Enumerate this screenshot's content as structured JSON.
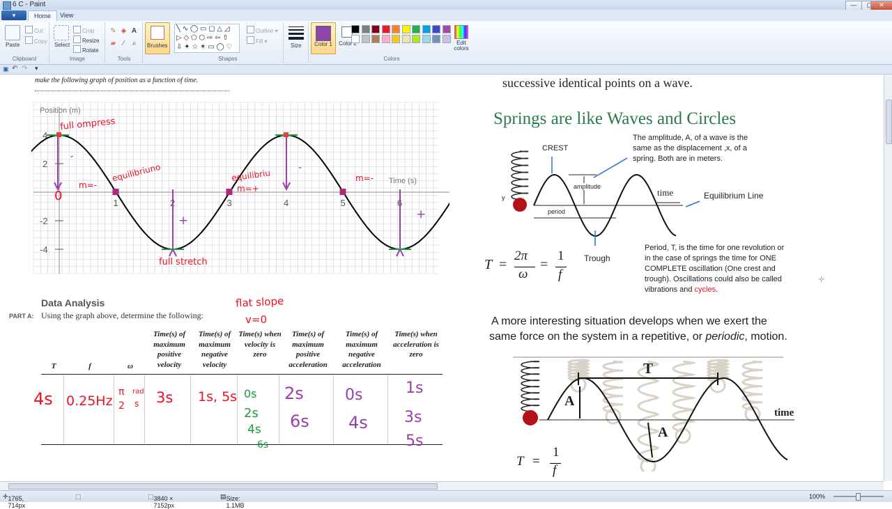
{
  "window": {
    "title": "6 C - Paint",
    "minimize_glyph": "—",
    "maximize_glyph": "▢",
    "close_glyph": "✕"
  },
  "tabs": [
    {
      "label": "Home"
    },
    {
      "label": "View"
    }
  ],
  "ribbon": {
    "clipboard": {
      "label": "Clipboard",
      "paste": "Paste",
      "cut": "Cut",
      "copy": "Copy"
    },
    "image": {
      "label": "Image",
      "select": "Select",
      "crop": "Crop",
      "resize": "Resize",
      "rotate": "Rotate"
    },
    "tools": {
      "label": "Tools",
      "text_glyph": "A"
    },
    "brushes": {
      "label": "Brushes"
    },
    "shapes": {
      "label": "Shapes",
      "outline": "Outline",
      "fill": "Fill"
    },
    "size": {
      "label": "Size"
    },
    "colors": {
      "label": "Colors",
      "color1": "Color 1",
      "color2": "Color 2",
      "edit": "Edit colors",
      "accent": "#8e44ad",
      "palette": [
        "#000000",
        "#7f7f7f",
        "#880015",
        "#ed1c24",
        "#ff7f27",
        "#fff200",
        "#22b14c",
        "#00a2e8",
        "#3f48cc",
        "#a349a4",
        "#ffffff",
        "#c3c3c3",
        "#b97a57",
        "#ffaec9",
        "#ffc90e",
        "#efe4b0",
        "#b5e61d",
        "#99d9ea",
        "#7092be",
        "#c8bfe7"
      ]
    }
  },
  "status": {
    "cursor": "1765, 714px",
    "dimensions": "3840 × 7152px",
    "size": "Size: 1.1MB",
    "zoom": "100%"
  },
  "left_page": {
    "intro": "make the following graph of position as a function of time.",
    "graph": {
      "y_axis_label": "Position (m)",
      "x_axis_label": "Time (s)",
      "y_ticks": [
        "4",
        "2",
        "0",
        "-2",
        "-4"
      ],
      "x_ticks": [
        "1",
        "2",
        "3",
        "4",
        "5",
        "6"
      ],
      "notes": {
        "full_compress": "full ompress",
        "equilibrium1": "equilibriuno",
        "m_minus": "m=-",
        "equilibrium2": "equilibriu",
        "m_plus": "m=+",
        "m_minus2": "m=-",
        "full_stretch": "full stretch",
        "zero": "0",
        "plus": "+",
        "dash": "-"
      }
    },
    "data_analysis": {
      "heading": "Data Analysis",
      "part": "PART A:",
      "instruction": "Using the graph above, determine the following:",
      "note_line1": "flat slope",
      "note_line2": "v=0",
      "columns": [
        "T",
        "f",
        "ω",
        "Time(s) of maximum positive velocity",
        "Time(s) of maximum negative velocity",
        "Time(s) when velocity is zero",
        "Time(s) of maximum positive acceleration",
        "Time(s) of maximum negative acceleration",
        "Time(s) when acceleration is zero"
      ],
      "answers": {
        "T": "4s",
        "f": "0.25Hz",
        "w_num": "π",
        "w_den": "2",
        "w_unit_num": "rad",
        "w_unit_den": "s",
        "max_pos_v": "3s",
        "max_neg_v": "1s, 5s",
        "v_zero": [
          "0s",
          "2s",
          "4s",
          "6s"
        ],
        "max_pos_a": [
          "2s",
          "6s"
        ],
        "max_neg_a": [
          "0s",
          "4s"
        ],
        "a_zero": [
          "1s",
          "3s",
          "5s"
        ]
      }
    }
  },
  "right_page": {
    "top_line": "successive identical points on a wave.",
    "heading": "Springs are like Waves and Circles",
    "amplitude_text": [
      "The amplitude, A, of a wave is the",
      "same as the displacement ,x, of a",
      "spring. Both are in meters."
    ],
    "diagram_labels": {
      "crest": "CREST",
      "amplitude": "amplitude",
      "time": "time",
      "equilibrium": "Equilibrium Line",
      "y": "y",
      "period": "period",
      "trough": "Trough"
    },
    "formula": {
      "T": "T",
      "eq": "=",
      "two_pi": "2π",
      "omega": "ω",
      "one": "1",
      "f": "f"
    },
    "period_text": [
      "Period, T, is the time for one revolution or",
      "in the case of springs the time for ONE",
      "COMPLETE oscillation (One crest and",
      "trough). Oscillations could also be called"
    ],
    "period_last": "vibrations and ",
    "cycles": "cycles",
    "period_end": ".",
    "interesting": [
      "A more interesting situation develops when we exert the",
      "same force on the system in a repetitive, or"
    ],
    "periodic": "periodic",
    "motion": ", motion.",
    "diagram2": {
      "T": "T",
      "A": "A",
      "time": "time"
    },
    "formula2": {
      "T": "T",
      "eq": "=",
      "one": "1",
      "f": "f"
    }
  }
}
